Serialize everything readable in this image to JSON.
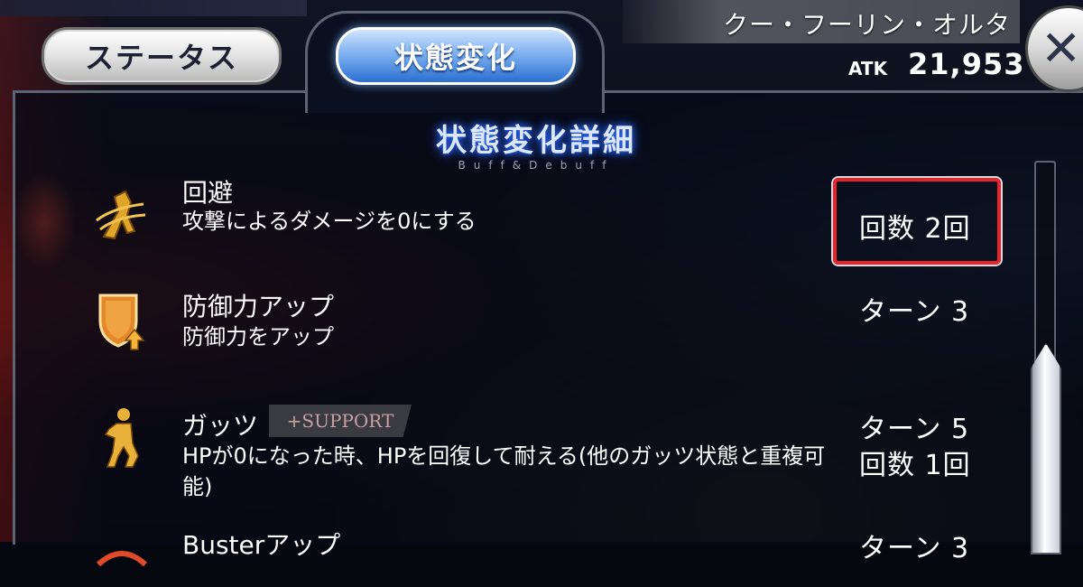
{
  "tabs": {
    "status_label": "ステータス",
    "state_label": "状態変化"
  },
  "enemy": {
    "name": "クー・フーリン・オルタ",
    "atk_label": "ATK",
    "atk_value": "21,953"
  },
  "close_symbol": "✕",
  "panel": {
    "title": "状態変化詳細",
    "subtitle": "Buff&Debuff"
  },
  "effects": [
    {
      "icon": "evade-icon",
      "name": "回避",
      "description": "攻撃によるダメージを0にする",
      "values": [
        "回数 2回"
      ]
    },
    {
      "icon": "defense-up-icon",
      "name": "防御力アップ",
      "description": "防御力をアップ",
      "values": [
        "ターン 3"
      ]
    },
    {
      "icon": "guts-icon",
      "name": "ガッツ",
      "support_badge": "+SUPPORT",
      "description": "HPが0になった時、HPを回復して耐える(他のガッツ状態と重複可能)",
      "values": [
        "ターン 5",
        "回数 1回"
      ]
    },
    {
      "icon": "buster-up-icon",
      "name": "Busterアップ",
      "values": [
        "ターン 3"
      ]
    }
  ],
  "colors": {
    "highlight": "#e8232b",
    "active_tab": "#2a6fd1",
    "title_glow": "#2f6bff"
  }
}
